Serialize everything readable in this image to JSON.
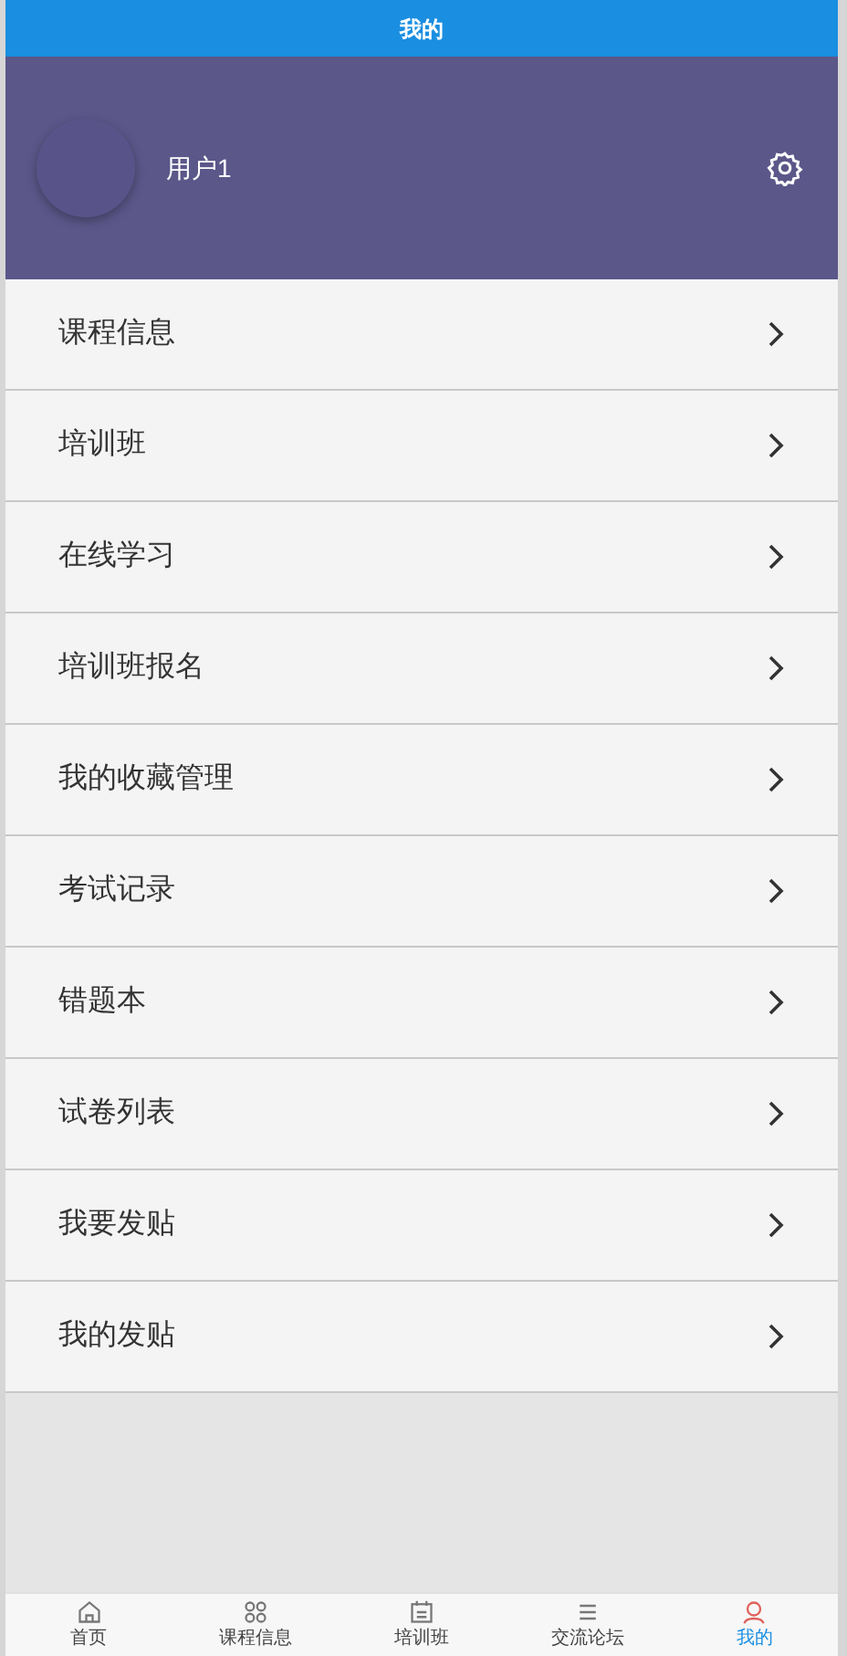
{
  "title": "我的",
  "profile": {
    "username": "用户1"
  },
  "menu": [
    {
      "label": "课程信息"
    },
    {
      "label": "培训班"
    },
    {
      "label": "在线学习"
    },
    {
      "label": "培训班报名"
    },
    {
      "label": "我的收藏管理"
    },
    {
      "label": "考试记录"
    },
    {
      "label": "错题本"
    },
    {
      "label": "试卷列表"
    },
    {
      "label": "我要发贴"
    },
    {
      "label": "我的发贴"
    }
  ],
  "tab_bar": [
    {
      "label": "首页",
      "kind": "home",
      "selected": false
    },
    {
      "label": "课程信息",
      "kind": "grid",
      "selected": false
    },
    {
      "label": "培训班",
      "kind": "board",
      "selected": false
    },
    {
      "label": "交流论坛",
      "kind": "list",
      "selected": false
    },
    {
      "label": "我的",
      "kind": "user",
      "selected": true
    }
  ]
}
